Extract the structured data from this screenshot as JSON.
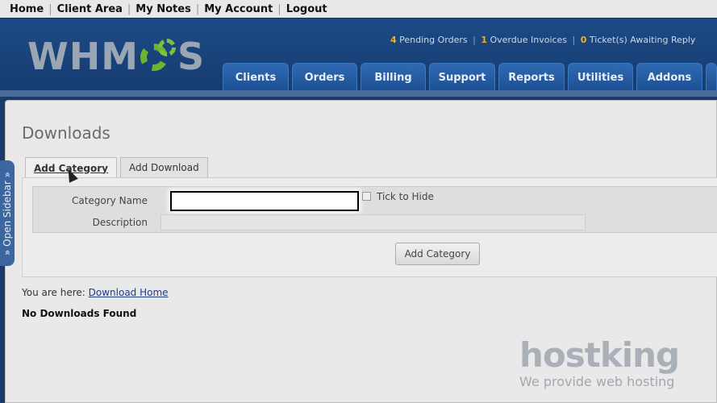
{
  "topnav": {
    "items": [
      "Home",
      "Client Area",
      "My Notes",
      "My Account",
      "Logout"
    ]
  },
  "header": {
    "logo_text_left": "WHM",
    "logo_text_right": "S",
    "stats": {
      "pending_count": "4",
      "pending_label": "Pending Orders",
      "overdue_count": "1",
      "overdue_label": "Overdue Invoices",
      "tickets_count": "0",
      "tickets_label": "Ticket(s) Awaiting Reply"
    },
    "tabs": [
      "Clients",
      "Orders",
      "Billing",
      "Support",
      "Reports",
      "Utilities",
      "Addons"
    ]
  },
  "sidebar": {
    "label": "» Open Sidebar »"
  },
  "main": {
    "title": "Downloads",
    "form_tabs": [
      "Add Category",
      "Add Download"
    ],
    "fields": {
      "category_label": "Category Name",
      "category_value": "",
      "tick_label": "Tick to Hide",
      "description_label": "Description",
      "description_value": ""
    },
    "submit_label": "Add Category",
    "breadcrumb_prefix": "You are here:",
    "breadcrumb_link": "Download Home",
    "empty_message": "No Downloads Found"
  },
  "watermark": {
    "brand": "hostking",
    "tagline": "We provide web hosting"
  },
  "colors": {
    "header_bg": "#1a3a6b",
    "tab_bg": "#2a5fa6",
    "accent_number": "#f0b323",
    "logo_green": "#6bb52f"
  }
}
